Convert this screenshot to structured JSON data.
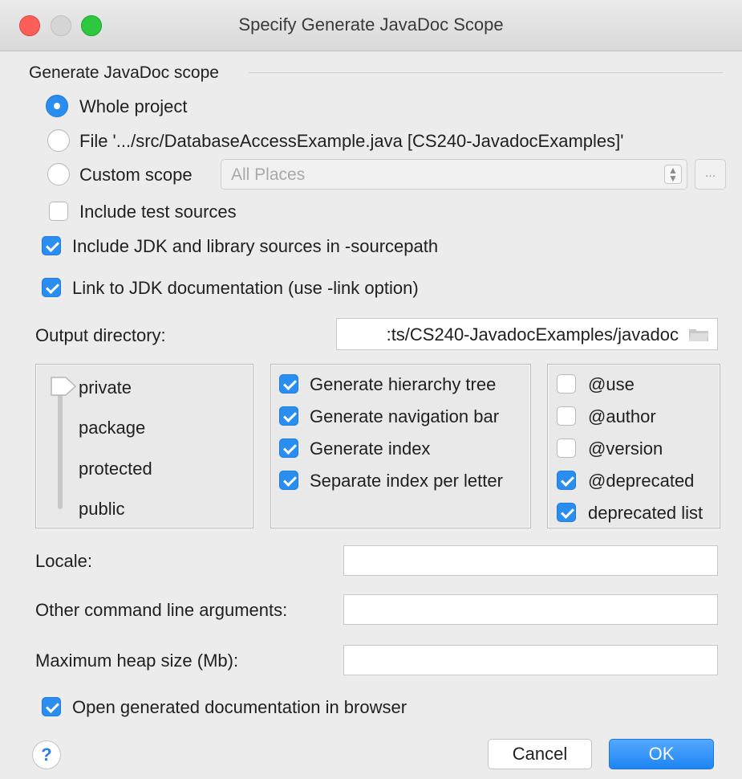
{
  "window": {
    "title": "Specify Generate JavaDoc Scope"
  },
  "scope": {
    "section_label": "Generate JavaDoc scope",
    "whole_project_label": "Whole project",
    "file_label": "File '.../src/DatabaseAccessExample.java [CS240-JavadocExamples]'",
    "custom_scope_label": "Custom scope",
    "custom_scope_value": "All Places",
    "custom_scope_more": "...",
    "include_test_sources_label": "Include test sources",
    "selected": "whole_project"
  },
  "options": {
    "include_jdk_label": "Include JDK and library sources in -sourcepath",
    "include_jdk_checked": true,
    "link_jdk_label": "Link to JDK documentation (use -link option)",
    "link_jdk_checked": true
  },
  "output": {
    "label": "Output directory:",
    "value": ":ts/CS240-JavadocExamples/javadoc"
  },
  "visibility": {
    "levels": [
      "private",
      "package",
      "protected",
      "public"
    ],
    "selected": "private"
  },
  "generate": {
    "items": [
      {
        "label": "Generate hierarchy tree",
        "checked": true
      },
      {
        "label": "Generate navigation bar",
        "checked": true
      },
      {
        "label": "Generate index",
        "checked": true
      },
      {
        "label": "Separate index per letter",
        "checked": true
      }
    ]
  },
  "tags": {
    "items": [
      {
        "label": "@use",
        "checked": false
      },
      {
        "label": "@author",
        "checked": false
      },
      {
        "label": "@version",
        "checked": false
      },
      {
        "label": "@deprecated",
        "checked": true
      },
      {
        "label": "deprecated list",
        "checked": true
      }
    ]
  },
  "fields": {
    "locale_label": "Locale:",
    "locale_value": "",
    "other_args_label": "Other command line arguments:",
    "other_args_value": "",
    "heap_label": "Maximum heap size (Mb):",
    "heap_value": ""
  },
  "footer": {
    "open_browser_label": "Open generated documentation in browser",
    "open_browser_checked": true,
    "help_label": "?",
    "cancel_label": "Cancel",
    "ok_label": "OK"
  },
  "colors": {
    "accent": "#2a8ef0",
    "close": "#fc5f57",
    "maximize": "#2bc840"
  }
}
